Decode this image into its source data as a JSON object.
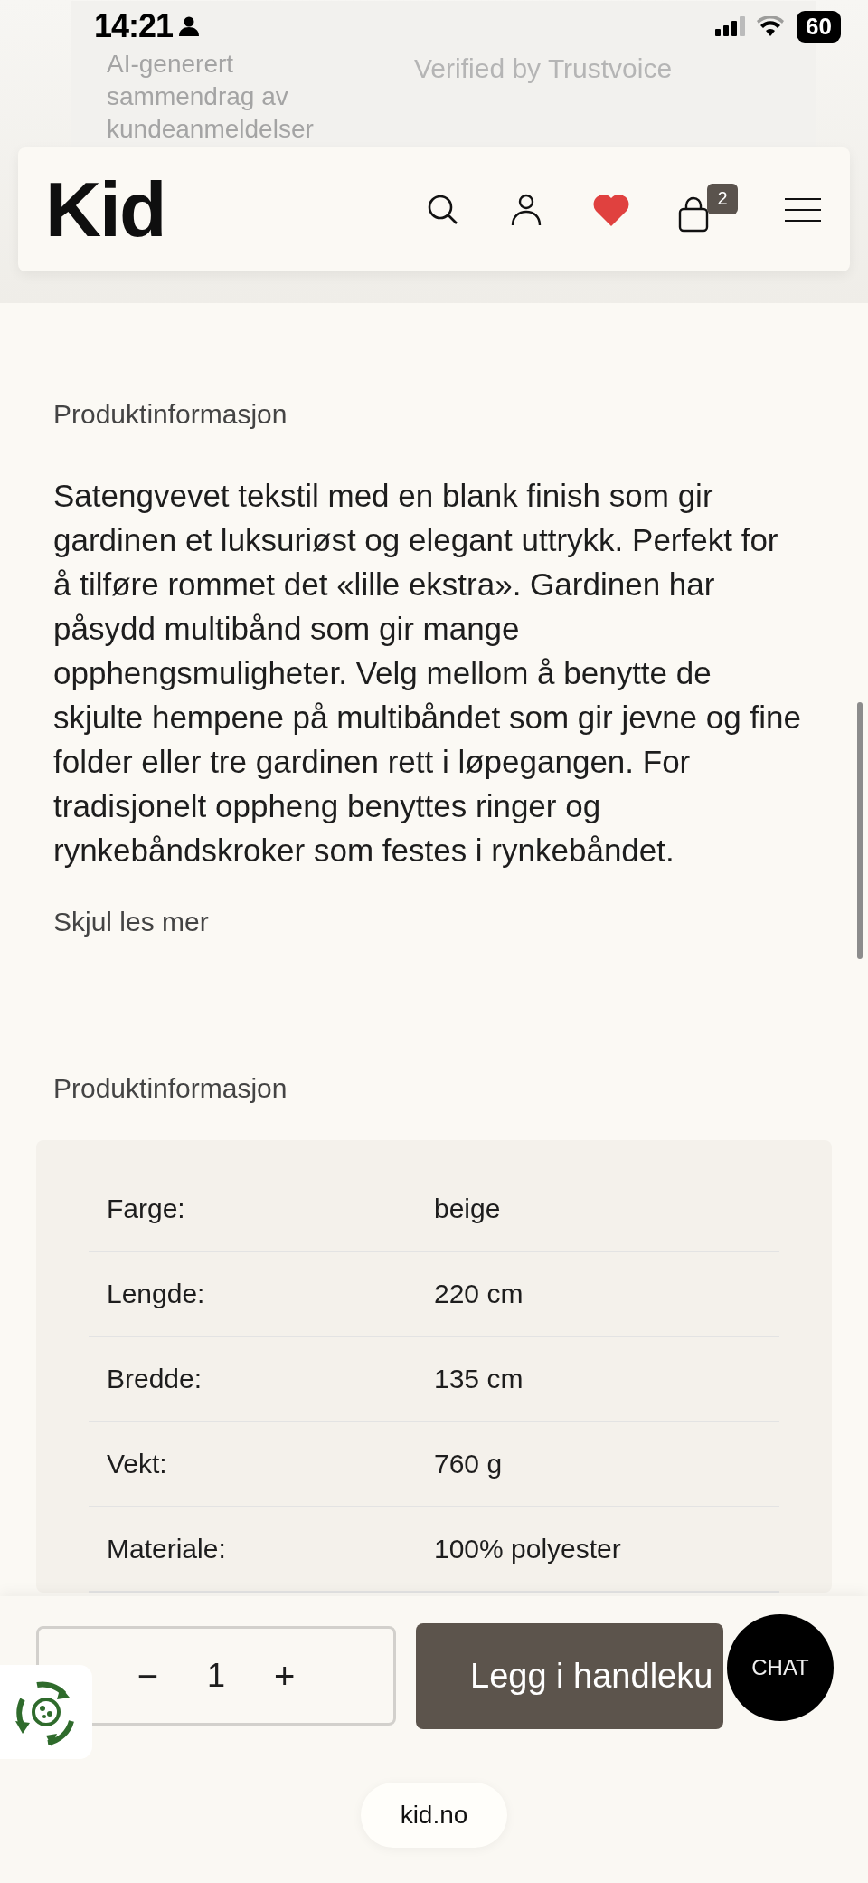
{
  "status_bar": {
    "time": "14:21",
    "battery": "60"
  },
  "review_card": {
    "title_lines": [
      "AI-generert",
      "sammendrag av",
      "kundeanmeldelser"
    ],
    "verified": "Verified by Trustvoice"
  },
  "header": {
    "logo": "Kid",
    "cart_count": "2",
    "favorite": true
  },
  "description": {
    "heading": "Produktinformasjon",
    "text": "Satengvevet tekstil med en blank finish som gir gardinen et luksuriøst og elegant uttrykk. Perfekt for å tilføre rommet det «lille ekstra». Gardinen har påsydd multibånd som gir mange opphengsmuligheter. Velg mellom å benytte de skjulte hempene på multibåndet som gir jevne og fine folder eller tre gardinen rett i løpegangen. For tradisjonelt oppheng benyttes ringer og rynkebåndskroker som festes i rynkebåndet.",
    "toggle": "Skjul les mer"
  },
  "specs": {
    "heading": "Produktinformasjon",
    "rows": [
      {
        "label": "Farge:",
        "value": "beige"
      },
      {
        "label": "Lengde:",
        "value": "220 cm"
      },
      {
        "label": "Bredde:",
        "value": "135 cm"
      },
      {
        "label": "Vekt:",
        "value": "760 g"
      },
      {
        "label": "Materiale:",
        "value": "100% polyester"
      }
    ]
  },
  "purchase_bar": {
    "minus": "−",
    "quantity": "1",
    "plus": "+",
    "add_button": "Legg i handleku",
    "chat": "CHAT"
  },
  "url_bar": {
    "url": "kid.no"
  }
}
